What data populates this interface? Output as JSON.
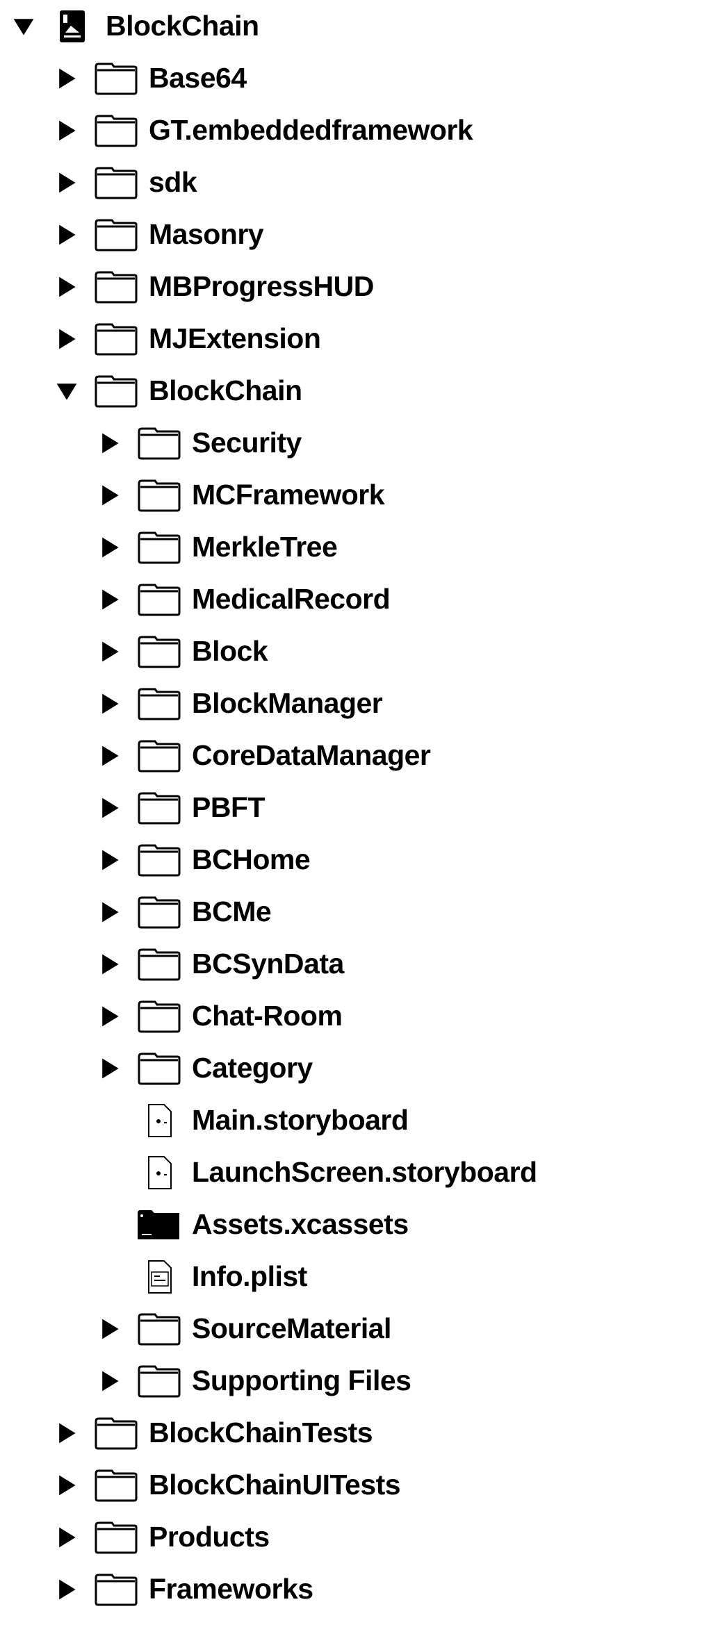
{
  "navigator": {
    "rows": [
      {
        "label": "BlockChain",
        "level": 0,
        "disclosure": "expanded",
        "icon": "project-icon"
      },
      {
        "label": "Base64",
        "level": 1,
        "disclosure": "collapsed",
        "icon": "folder-icon"
      },
      {
        "label": "GT.embeddedframework",
        "level": 1,
        "disclosure": "collapsed",
        "icon": "folder-icon"
      },
      {
        "label": "sdk",
        "level": 1,
        "disclosure": "collapsed",
        "icon": "folder-icon"
      },
      {
        "label": "Masonry",
        "level": 1,
        "disclosure": "collapsed",
        "icon": "folder-icon"
      },
      {
        "label": "MBProgressHUD",
        "level": 1,
        "disclosure": "collapsed",
        "icon": "folder-icon"
      },
      {
        "label": "MJExtension",
        "level": 1,
        "disclosure": "collapsed",
        "icon": "folder-icon"
      },
      {
        "label": "BlockChain",
        "level": 1,
        "disclosure": "expanded",
        "icon": "folder-icon"
      },
      {
        "label": "Security",
        "level": 2,
        "disclosure": "collapsed",
        "icon": "folder-icon"
      },
      {
        "label": "MCFramework",
        "level": 2,
        "disclosure": "collapsed",
        "icon": "folder-icon"
      },
      {
        "label": "MerkleTree",
        "level": 2,
        "disclosure": "collapsed",
        "icon": "folder-icon"
      },
      {
        "label": "MedicalRecord",
        "level": 2,
        "disclosure": "collapsed",
        "icon": "folder-icon"
      },
      {
        "label": "Block",
        "level": 2,
        "disclosure": "collapsed",
        "icon": "folder-icon"
      },
      {
        "label": "BlockManager",
        "level": 2,
        "disclosure": "collapsed",
        "icon": "folder-icon"
      },
      {
        "label": "CoreDataManager",
        "level": 2,
        "disclosure": "collapsed",
        "icon": "folder-icon"
      },
      {
        "label": "PBFT",
        "level": 2,
        "disclosure": "collapsed",
        "icon": "folder-icon"
      },
      {
        "label": "BCHome",
        "level": 2,
        "disclosure": "collapsed",
        "icon": "folder-icon"
      },
      {
        "label": "BCMe",
        "level": 2,
        "disclosure": "collapsed",
        "icon": "folder-icon"
      },
      {
        "label": "BCSynData",
        "level": 2,
        "disclosure": "collapsed",
        "icon": "folder-icon"
      },
      {
        "label": "Chat-Room",
        "level": 2,
        "disclosure": "collapsed",
        "icon": "folder-icon"
      },
      {
        "label": "Category",
        "level": 2,
        "disclosure": "collapsed",
        "icon": "folder-icon"
      },
      {
        "label": "Main.storyboard",
        "level": 2,
        "disclosure": "none",
        "icon": "storyboard-file-icon"
      },
      {
        "label": "LaunchScreen.storyboard",
        "level": 2,
        "disclosure": "none",
        "icon": "storyboard-file-icon"
      },
      {
        "label": "Assets.xcassets",
        "level": 2,
        "disclosure": "none",
        "icon": "asset-catalog-icon"
      },
      {
        "label": "Info.plist",
        "level": 2,
        "disclosure": "none",
        "icon": "plist-file-icon"
      },
      {
        "label": "SourceMaterial",
        "level": 2,
        "disclosure": "collapsed",
        "icon": "folder-icon"
      },
      {
        "label": "Supporting Files",
        "level": 2,
        "disclosure": "collapsed",
        "icon": "folder-icon"
      },
      {
        "label": "BlockChainTests",
        "level": 1,
        "disclosure": "collapsed",
        "icon": "folder-icon"
      },
      {
        "label": "BlockChainUITests",
        "level": 1,
        "disclosure": "collapsed",
        "icon": "folder-icon"
      },
      {
        "label": "Products",
        "level": 1,
        "disclosure": "collapsed",
        "icon": "folder-icon"
      },
      {
        "label": "Frameworks",
        "level": 1,
        "disclosure": "collapsed",
        "icon": "folder-icon"
      }
    ]
  }
}
